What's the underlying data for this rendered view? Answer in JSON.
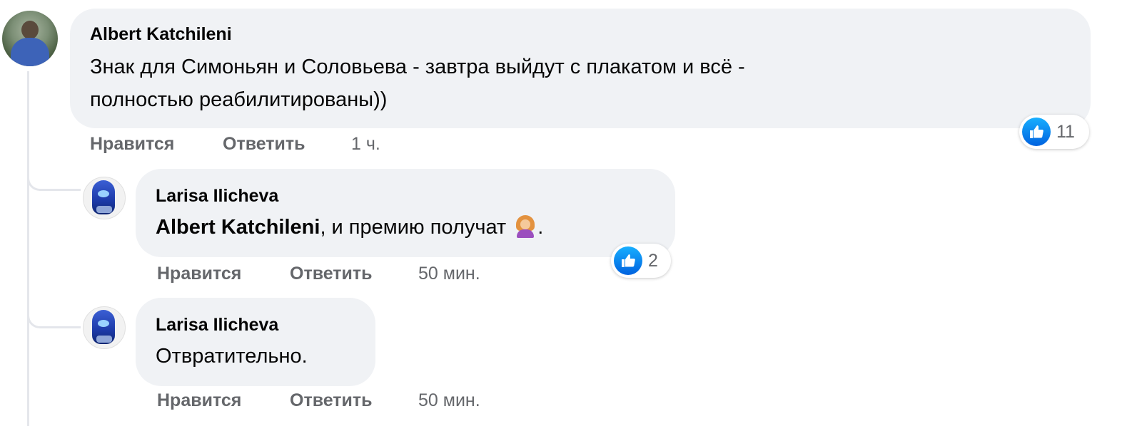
{
  "comments": [
    {
      "author": "Albert Katchileni",
      "text_line1": "Знак для Симоньян и Соловьева - завтра выйдут с плакатом и всё -",
      "text_line2": "полностью реабилитированы))",
      "like_label": "Нравится",
      "reply_label": "Ответить",
      "time": "1 ч.",
      "reaction_count": "11",
      "reaction_icon": "like-icon"
    },
    {
      "author": "Larisa Ilicheva",
      "mention": "Albert Katchileni",
      "text": ", и премию получат",
      "text_end": ".",
      "emoji": "woman-shrugging-emoji",
      "like_label": "Нравится",
      "reply_label": "Ответить",
      "time": "50 мин.",
      "reaction_count": "2",
      "reaction_icon": "like-icon"
    },
    {
      "author": "Larisa Ilicheva",
      "text": "Отвратительно.",
      "like_label": "Нравится",
      "reply_label": "Ответить",
      "time": "50 мин."
    }
  ],
  "colors": {
    "bubble": "#f0f2f5",
    "secondary_text": "#65676b",
    "like_blue": "#1877f2",
    "thread_line": "#e4e6eb"
  }
}
